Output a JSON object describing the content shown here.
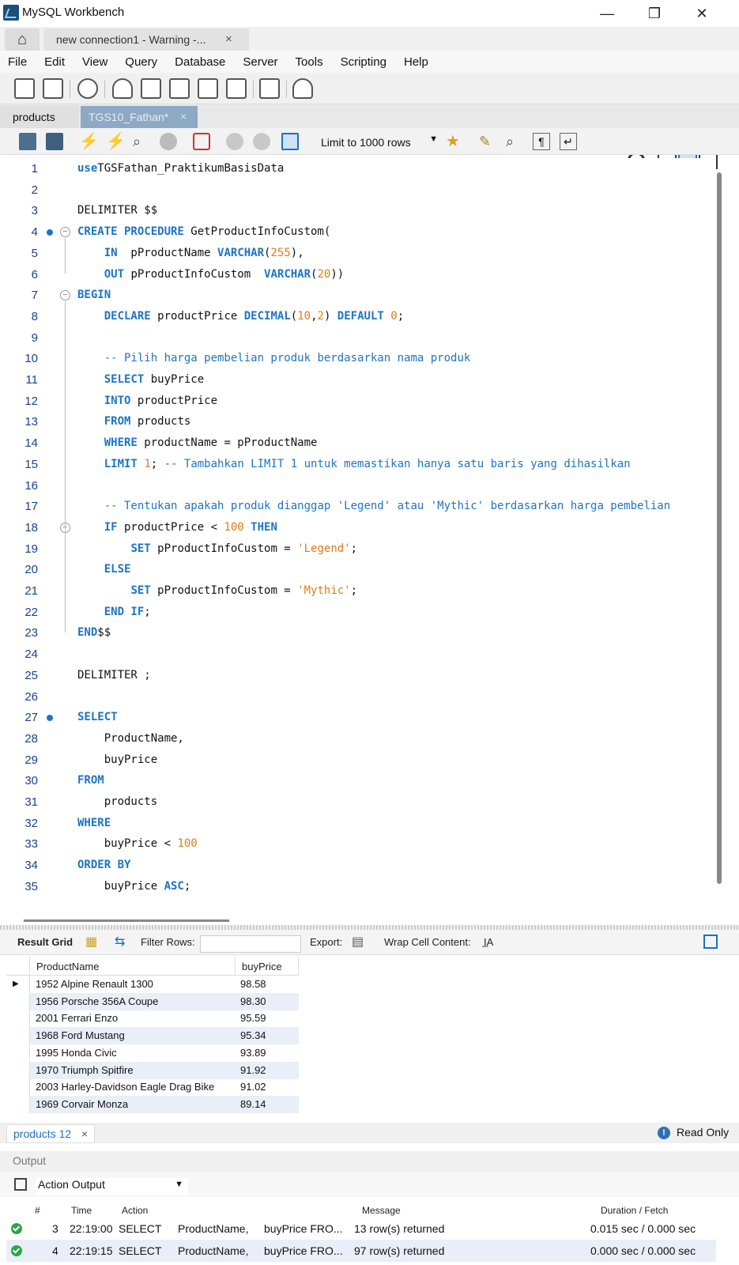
{
  "window": {
    "title": "MySQL Workbench"
  },
  "tabs": {
    "connection": "new connection1 - Warning -...",
    "close": "×"
  },
  "menu": [
    "File",
    "Edit",
    "View",
    "Query",
    "Database",
    "Server",
    "Tools",
    "Scripting",
    "Help"
  ],
  "editor_tabs": {
    "products": "products",
    "active": "TGS10_Fathan*",
    "close": "×"
  },
  "sql_toolbar": {
    "limit": "Limit to 1000 rows"
  },
  "lines": [
    {
      "n": "1",
      "html": [
        [
          "kw",
          "use"
        ],
        [
          "",
          "TGSFathan_PraktikumBasisData"
        ]
      ]
    },
    {
      "n": "2",
      "html": []
    },
    {
      "n": "3",
      "html": [
        [
          "",
          "DELIMITER $$"
        ]
      ]
    },
    {
      "n": "4",
      "html": [
        [
          "kw",
          "CREATE PROCEDURE"
        ],
        [
          "",
          " GetProductInfoCustom("
        ]
      ]
    },
    {
      "n": "5",
      "html": [
        [
          "",
          "    "
        ],
        [
          "kw",
          "IN"
        ],
        [
          "",
          "  pProductName "
        ],
        [
          "kw",
          "VARCHAR"
        ],
        [
          "",
          "("
        ],
        [
          "num",
          "255"
        ],
        [
          "",
          "),"
        ]
      ]
    },
    {
      "n": "6",
      "html": [
        [
          "",
          "    "
        ],
        [
          "kw",
          "OUT"
        ],
        [
          "",
          " pProductInfoCustom  "
        ],
        [
          "kw",
          "VARCHAR"
        ],
        [
          "",
          "("
        ],
        [
          "num",
          "20"
        ],
        [
          "",
          "))"
        ]
      ]
    },
    {
      "n": "7",
      "html": [
        [
          "kw",
          "BEGIN"
        ]
      ]
    },
    {
      "n": "8",
      "html": [
        [
          "",
          "    "
        ],
        [
          "kw",
          "DECLARE"
        ],
        [
          "",
          " productPrice "
        ],
        [
          "kw",
          "DECIMAL"
        ],
        [
          "",
          "("
        ],
        [
          "num",
          "10"
        ],
        [
          "",
          ","
        ],
        [
          "num",
          "2"
        ],
        [
          "",
          ") "
        ],
        [
          "kw",
          "DEFAULT"
        ],
        [
          "",
          " "
        ],
        [
          "num",
          "0"
        ],
        [
          "",
          ";"
        ]
      ]
    },
    {
      "n": "9",
      "html": []
    },
    {
      "n": "10",
      "html": [
        [
          "",
          "    "
        ],
        [
          "cm",
          "-- Pilih harga pembelian produk berdasarkan nama produk"
        ]
      ]
    },
    {
      "n": "11",
      "html": [
        [
          "",
          "    "
        ],
        [
          "kw",
          "SELECT"
        ],
        [
          "",
          " buyPrice"
        ]
      ]
    },
    {
      "n": "12",
      "html": [
        [
          "",
          "    "
        ],
        [
          "kw",
          "INTO"
        ],
        [
          "",
          " productPrice"
        ]
      ]
    },
    {
      "n": "13",
      "html": [
        [
          "",
          "    "
        ],
        [
          "kw",
          "FROM"
        ],
        [
          "",
          " products"
        ]
      ]
    },
    {
      "n": "14",
      "html": [
        [
          "",
          "    "
        ],
        [
          "kw",
          "WHERE"
        ],
        [
          "",
          " productName = pProductName"
        ]
      ]
    },
    {
      "n": "15",
      "html": [
        [
          "",
          "    "
        ],
        [
          "kw",
          "LIMIT"
        ],
        [
          "",
          " "
        ],
        [
          "num",
          "1"
        ],
        [
          "",
          "; "
        ],
        [
          "cm",
          "-- Tambahkan LIMIT 1 untuk memastikan hanya satu baris yang dihasilkan"
        ]
      ]
    },
    {
      "n": "16",
      "html": []
    },
    {
      "n": "17",
      "html": [
        [
          "",
          "    "
        ],
        [
          "cm",
          "-- Tentukan apakah produk dianggap 'Legend' atau 'Mythic' berdasarkan harga pembelian"
        ]
      ]
    },
    {
      "n": "18",
      "html": [
        [
          "",
          "    "
        ],
        [
          "kw",
          "IF"
        ],
        [
          "",
          " productPrice < "
        ],
        [
          "num",
          "100"
        ],
        [
          "",
          " "
        ],
        [
          "kw",
          "THEN"
        ]
      ]
    },
    {
      "n": "19",
      "html": [
        [
          "",
          "        "
        ],
        [
          "kw",
          "SET"
        ],
        [
          "",
          " pProductInfoCustom = "
        ],
        [
          "str",
          "'Legend'"
        ],
        [
          "",
          ";"
        ]
      ]
    },
    {
      "n": "20",
      "html": [
        [
          "",
          "    "
        ],
        [
          "kw",
          "ELSE"
        ]
      ]
    },
    {
      "n": "21",
      "html": [
        [
          "",
          "        "
        ],
        [
          "kw",
          "SET"
        ],
        [
          "",
          " pProductInfoCustom = "
        ],
        [
          "str",
          "'Mythic'"
        ],
        [
          "",
          ";"
        ]
      ]
    },
    {
      "n": "22",
      "html": [
        [
          "",
          "    "
        ],
        [
          "kw",
          "END IF"
        ],
        [
          "",
          ";"
        ]
      ]
    },
    {
      "n": "23",
      "html": [
        [
          "kw",
          "END"
        ],
        [
          "",
          "$$"
        ]
      ]
    },
    {
      "n": "24",
      "html": []
    },
    {
      "n": "25",
      "html": [
        [
          "",
          "DELIMITER ;"
        ]
      ]
    },
    {
      "n": "26",
      "html": []
    },
    {
      "n": "27",
      "html": [
        [
          "kw",
          "SELECT"
        ]
      ]
    },
    {
      "n": "28",
      "html": [
        [
          "",
          "    ProductName,"
        ]
      ]
    },
    {
      "n": "29",
      "html": [
        [
          "",
          "    buyPrice"
        ]
      ]
    },
    {
      "n": "30",
      "html": [
        [
          "kw",
          "FROM"
        ]
      ]
    },
    {
      "n": "31",
      "html": [
        [
          "",
          "    products"
        ]
      ]
    },
    {
      "n": "32",
      "html": [
        [
          "kw",
          "WHERE"
        ]
      ]
    },
    {
      "n": "33",
      "html": [
        [
          "",
          "    buyPrice < "
        ],
        [
          "num",
          "100"
        ]
      ]
    },
    {
      "n": "34",
      "html": [
        [
          "kw",
          "ORDER BY"
        ]
      ]
    },
    {
      "n": "35",
      "html": [
        [
          "",
          "    buyPrice "
        ],
        [
          "kw",
          "ASC"
        ],
        [
          "",
          ";"
        ]
      ]
    }
  ],
  "result_toolbar": {
    "grid": "Result Grid",
    "filter": "Filter Rows:",
    "export": "Export:",
    "wrap": "Wrap Cell Content:"
  },
  "grid": {
    "columns": [
      "ProductName",
      "buyPrice"
    ],
    "rows": [
      [
        "1952 Alpine Renault 1300",
        "98.58"
      ],
      [
        "1956 Porsche 356A Coupe",
        "98.30"
      ],
      [
        "2001 Ferrari Enzo",
        "95.59"
      ],
      [
        "1968 Ford Mustang",
        "95.34"
      ],
      [
        "1995 Honda Civic",
        "93.89"
      ],
      [
        "1970 Triumph Spitfire",
        "91.92"
      ],
      [
        "2003 Harley-Davidson Eagle Drag Bike",
        "91.02"
      ],
      [
        "1969 Corvair Monza",
        "89.14"
      ]
    ]
  },
  "result_tab": {
    "label": "products 12",
    "close": "×"
  },
  "readonly": "Read Only",
  "output": {
    "header": "Output",
    "selector": "Action Output",
    "columns": [
      "#",
      "Time",
      "Action",
      "Message",
      "Duration / Fetch"
    ],
    "rows": [
      {
        "num": "3",
        "time": "22:19:00",
        "action": "SELECT",
        "a2": "ProductName,",
        "a3": "buyPrice FRO...",
        "msg": "13 row(s) returned",
        "dur": "0.015 sec / 0.000 sec"
      },
      {
        "num": "4",
        "time": "22:19:15",
        "action": "SELECT",
        "a2": "ProductName,",
        "a3": "buyPrice FRO...",
        "msg": "97 row(s) returned",
        "dur": "0.000 sec / 0.000 sec"
      }
    ]
  }
}
